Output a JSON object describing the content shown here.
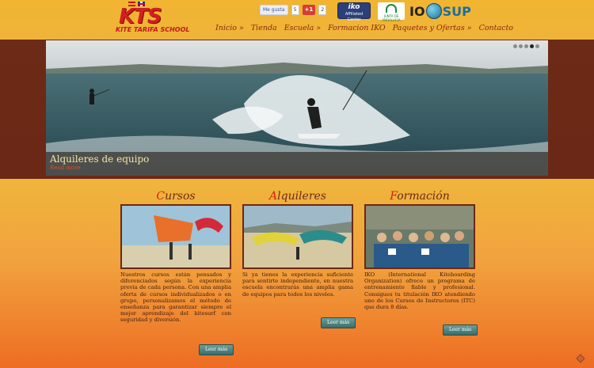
{
  "header": {
    "logo_main": "KTS",
    "logo_sub": "KITE TARIFA SCHOOL",
    "social": {
      "fb_label": "Me gusta",
      "fb_count": "5",
      "gplus_label": "+1",
      "gplus_count": "2"
    },
    "badges": {
      "iko_main": "iko",
      "iko_sub": "Affiliated Center",
      "junta_text": "JUNTA DE ANDALUCIA",
      "iosup_io": "IO",
      "iosup_sup": "SUP"
    },
    "nav": [
      {
        "label": "Inicio »"
      },
      {
        "label": "Tienda"
      },
      {
        "label": "Escuela »"
      },
      {
        "label": "Formacion IKO"
      },
      {
        "label": "Paquetes y Ofertas »"
      },
      {
        "label": "Contacto"
      }
    ]
  },
  "hero": {
    "title": "Alquileres de equipo",
    "more": "Read more",
    "slides_total": 5,
    "active_slide": 4
  },
  "columns": [
    {
      "title_first": "C",
      "title_rest": "ursos",
      "text": "Nuestros cursos están pensados y diferenciados según la experiencia previa de cada persona. Con una amplia oferta de cursos individualizados o en grupo, personalizamos el método de enseñanza para garantizar siempre el mejor aprendizaje del kitesurf con seguridad y diversión.",
      "button": "Leer más"
    },
    {
      "title_first": "A",
      "title_rest": "lquileres",
      "text": "Si ya tienes la experiencia suficiente para sentirte independiente, en nuestra escuela encontrarás una amplia gama de equipos para todos los niveles.",
      "button": "Leer más"
    },
    {
      "title_first": "F",
      "title_rest": "ormación",
      "text": "IKO (International Kiteboarding Organization) ofrece un programa de entrenamiento fiable y profesional. Consigues tu titulación IKO atendiendo uno de los Cursos de Instructores (ITC) que dura 8 días.",
      "button": "Leer más"
    }
  ],
  "colors": {
    "accent_red": "#cf2510",
    "nav_text": "#8a2a0e",
    "band_dark": "#6b2816",
    "button_teal": "#4a7e7a"
  }
}
